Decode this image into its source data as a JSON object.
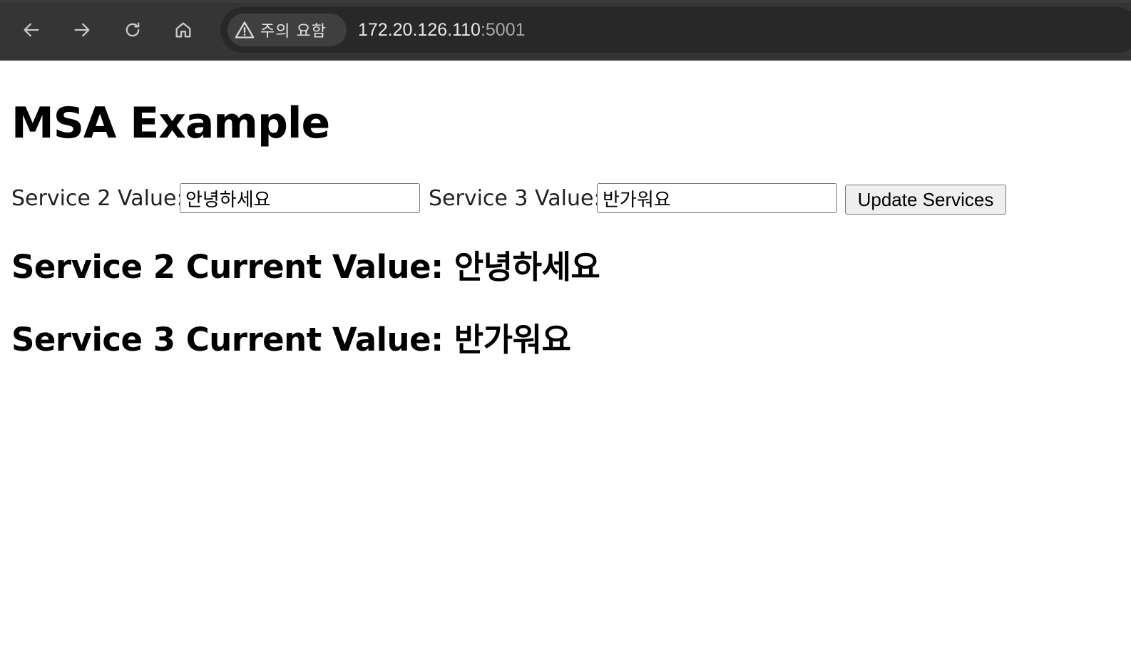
{
  "browser": {
    "security_chip_label": "주의 요함",
    "url_host": "172.20.126.110",
    "url_port": ":5001",
    "icons": {
      "back": "arrow-left-icon",
      "forward": "arrow-right-icon",
      "reload": "reload-icon",
      "home": "home-icon",
      "warning": "warning-triangle-icon"
    },
    "colors": {
      "toolbar": "#353535",
      "omnibox": "#282828",
      "chip": "#3f3f3f",
      "icon": "#c8c8c8"
    }
  },
  "page": {
    "title": "MSA Example",
    "form": {
      "service2_label": "Service 2 Value:",
      "service2_value": "안녕하세요",
      "service3_label": "Service 3 Value:",
      "service3_value": "반가워요",
      "update_button_label": "Update Services"
    },
    "current": {
      "service2": "Service 2 Current Value: 안녕하세요",
      "service3": "Service 3 Current Value: 반가워요"
    }
  }
}
